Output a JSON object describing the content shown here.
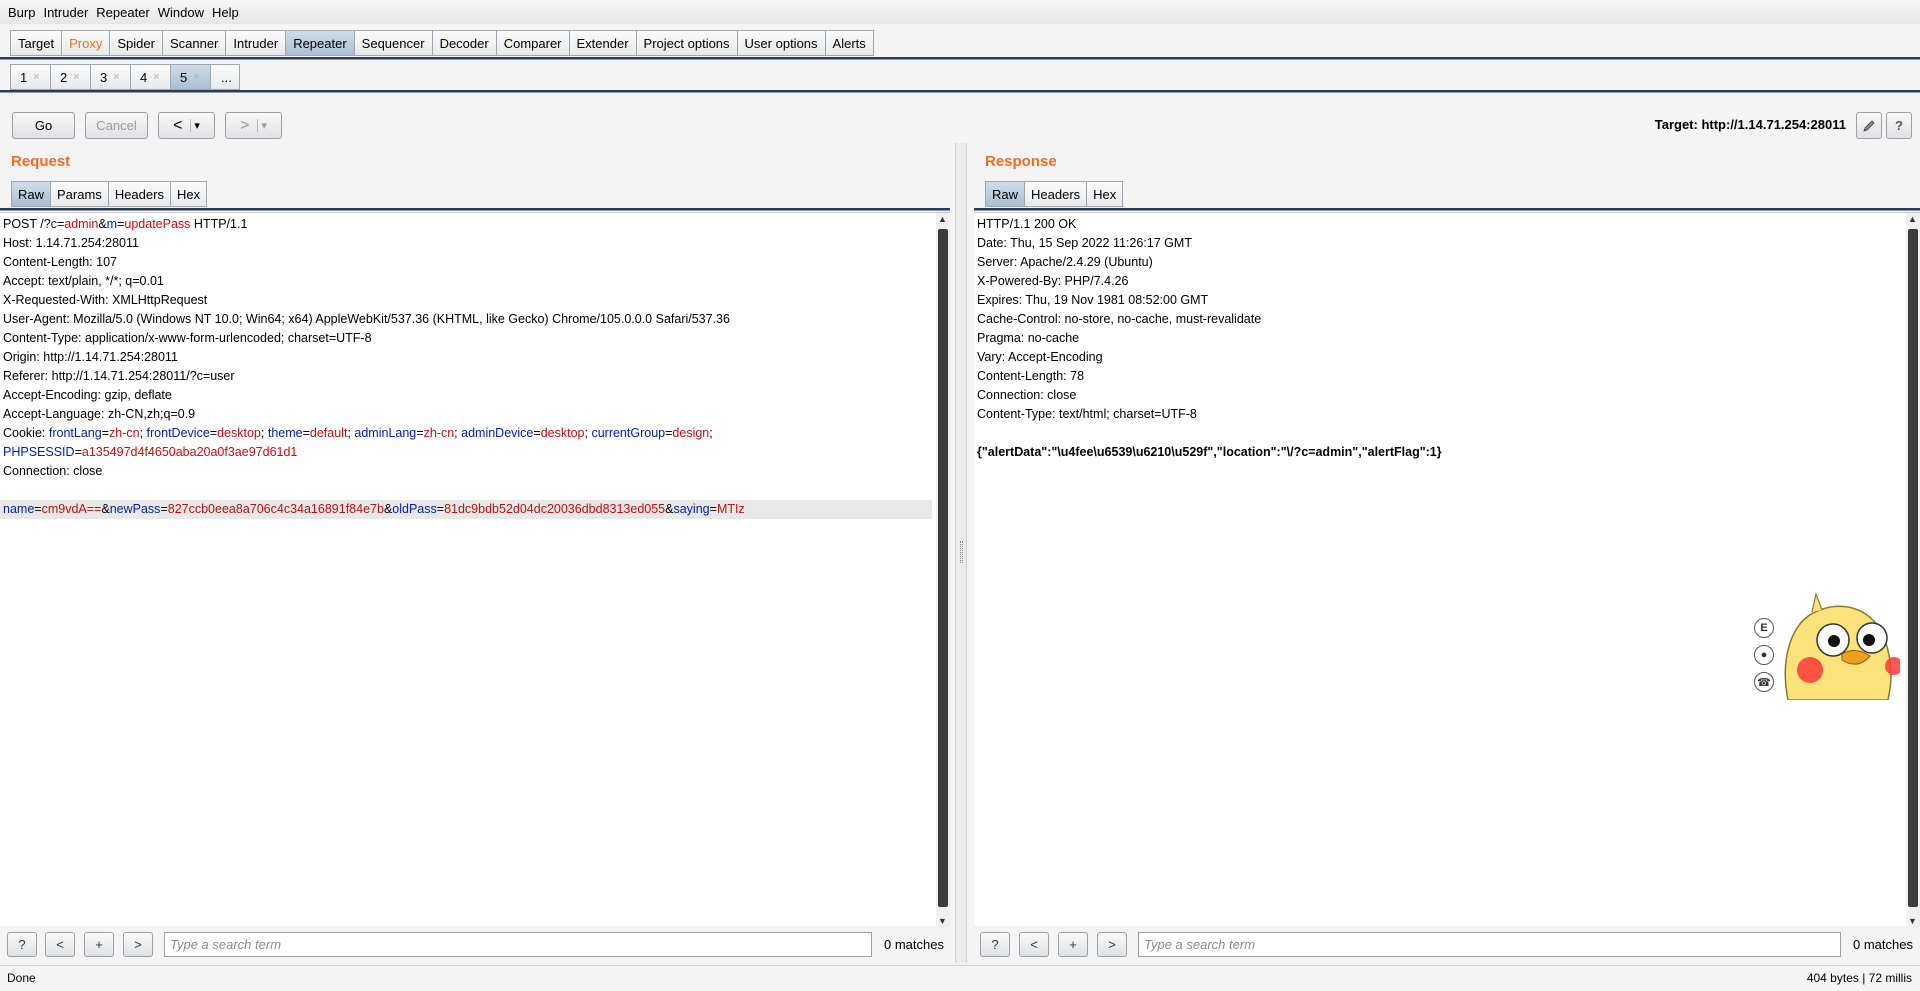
{
  "menu": [
    "Burp",
    "Intruder",
    "Repeater",
    "Window",
    "Help"
  ],
  "main_tabs": [
    "Target",
    "Proxy",
    "Spider",
    "Scanner",
    "Intruder",
    "Repeater",
    "Sequencer",
    "Decoder",
    "Comparer",
    "Extender",
    "Project options",
    "User options",
    "Alerts"
  ],
  "sub_tabs": [
    "1",
    "2",
    "3",
    "4",
    "5",
    "..."
  ],
  "toolbar": {
    "go": "Go",
    "cancel": "Cancel",
    "back": "<",
    "forward": ">",
    "dropdown": "▾"
  },
  "target": "Target: http://1.14.71.254:28011",
  "request": {
    "title": "Request",
    "tabs": [
      "Raw",
      "Params",
      "Headers",
      "Hex"
    ],
    "lines": [
      "POST /?c=admin&m=updatePass HTTP/1.1",
      "Host: 1.14.71.254:28011",
      "Content-Length: 107",
      "Accept: text/plain, */*; q=0.01",
      "X-Requested-With: XMLHttpRequest",
      "User-Agent: Mozilla/5.0 (Windows NT 10.0; Win64; x64) AppleWebKit/537.36 (KHTML, like Gecko) Chrome/105.0.0.0 Safari/537.36",
      "Content-Type: application/x-www-form-urlencoded; charset=UTF-8",
      "Origin: http://1.14.71.254:28011",
      "Referer: http://1.14.71.254:28011/?c=user",
      "Accept-Encoding: gzip, deflate",
      "Accept-Language: zh-CN,zh;q=0.9",
      "Cookie: frontLang=zh-cn; frontDevice=desktop; theme=default; adminLang=zh-cn; adminDevice=desktop; currentGroup=design;",
      "PHPSESSID=a135497d4f4650aba20a0f3ae97d61d1",
      "Connection: close",
      "",
      "name=cm9vdA==&newPass=827ccb0eea8a706c4c34a16891f84e7b&oldPass=81dc9bdb52d04dc20036dbd8313ed055&saying=MTIz"
    ]
  },
  "response": {
    "title": "Response",
    "tabs": [
      "Raw",
      "Headers",
      "Hex"
    ],
    "lines": [
      "HTTP/1.1 200 OK",
      "Date: Thu, 15 Sep 2022 11:26:17 GMT",
      "Server: Apache/2.4.29 (Ubuntu)",
      "X-Powered-By: PHP/7.4.26",
      "Expires: Thu, 19 Nov 1981 08:52:00 GMT",
      "Cache-Control: no-store, no-cache, must-revalidate",
      "Pragma: no-cache",
      "Vary: Accept-Encoding",
      "Content-Length: 78",
      "Connection: close",
      "Content-Type: text/html; charset=UTF-8",
      "",
      "{\"alertData\":\"\\u4fee\\u6539\\u6210\\u529f\",\"location\":\"\\/?c=admin\",\"alertFlag\":1}"
    ]
  },
  "search": {
    "help": "?",
    "prev": "<",
    "add": "+",
    "next": ">",
    "placeholder": "Type a search term",
    "request_matches": "0 matches",
    "response_matches": "0 matches"
  },
  "status": {
    "left": "Done",
    "right": "404 bytes | 72 millis"
  },
  "mascot_buttons": [
    "E",
    "●",
    "☎"
  ],
  "colors": {
    "accent": "#f26d24",
    "param_name": "#0022aa",
    "param_value": "#bb1111",
    "active_tab": "#a9c0d4"
  }
}
